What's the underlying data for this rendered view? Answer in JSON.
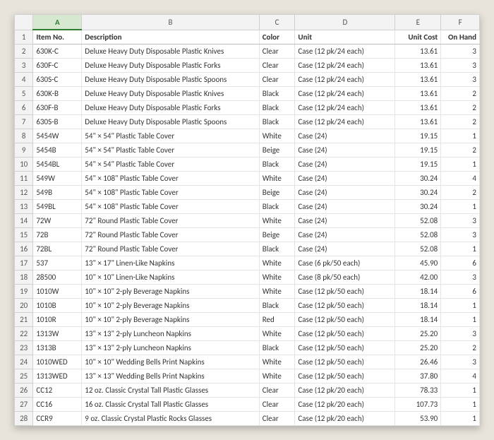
{
  "columns": [
    "A",
    "B",
    "C",
    "D",
    "E",
    "F"
  ],
  "selected_column": "A",
  "headers": {
    "item_no": "Item No.",
    "description": "Description",
    "color": "Color",
    "unit": "Unit",
    "unit_cost": "Unit Cost",
    "on_hand": "On Hand"
  },
  "rows": [
    {
      "n": 2,
      "item": "630K-C",
      "desc": "Deluxe Heavy Duty Disposable Plastic Knives",
      "color": "Clear",
      "unit": "Case (12 pk/24 each)",
      "cost": "13.61",
      "oh": "3"
    },
    {
      "n": 3,
      "item": "630F-C",
      "desc": "Deluxe Heavy Duty Disposable Plastic Forks",
      "color": "Clear",
      "unit": "Case (12 pk/24 each)",
      "cost": "13.61",
      "oh": "3"
    },
    {
      "n": 4,
      "item": "630S-C",
      "desc": "Deluxe Heavy Duty Disposable Plastic Spoons",
      "color": "Clear",
      "unit": "Case (12 pk/24 each)",
      "cost": "13.61",
      "oh": "3"
    },
    {
      "n": 5,
      "item": "630K-B",
      "desc": "Deluxe Heavy Duty Disposable Plastic Knives",
      "color": "Black",
      "unit": "Case (12 pk/24 each)",
      "cost": "13.61",
      "oh": "2"
    },
    {
      "n": 6,
      "item": "630F-B",
      "desc": "Deluxe Heavy Duty Disposable Plastic Forks",
      "color": "Black",
      "unit": "Case (12 pk/24 each)",
      "cost": "13.61",
      "oh": "2"
    },
    {
      "n": 7,
      "item": "630S-B",
      "desc": "Deluxe Heavy Duty Disposable Plastic Spoons",
      "color": "Black",
      "unit": "Case (12 pk/24 each)",
      "cost": "13.61",
      "oh": "2"
    },
    {
      "n": 8,
      "item": "5454W",
      "desc": "54\" × 54\" Plastic Table Cover",
      "color": "White",
      "unit": "Case (24)",
      "cost": "19.15",
      "oh": "1"
    },
    {
      "n": 9,
      "item": "5454B",
      "desc": "54\" × 54\" Plastic Table Cover",
      "color": "Beige",
      "unit": "Case (24)",
      "cost": "19.15",
      "oh": "2"
    },
    {
      "n": 10,
      "item": "5454BL",
      "desc": "54\" × 54\" Plastic Table Cover",
      "color": "Black",
      "unit": "Case (24)",
      "cost": "19.15",
      "oh": "1"
    },
    {
      "n": 11,
      "item": "549W",
      "desc": "54\" × 108\" Plastic Table Cover",
      "color": "White",
      "unit": "Case (24)",
      "cost": "30.24",
      "oh": "4"
    },
    {
      "n": 12,
      "item": "549B",
      "desc": "54\" × 108\" Plastic Table Cover",
      "color": "Beige",
      "unit": "Case (24)",
      "cost": "30.24",
      "oh": "2"
    },
    {
      "n": 13,
      "item": "549BL",
      "desc": "54\" × 108\" Plastic Table Cover",
      "color": "Black",
      "unit": "Case (24)",
      "cost": "30.24",
      "oh": "1"
    },
    {
      "n": 14,
      "item": "72W",
      "desc": "72\" Round Plastic Table Cover",
      "color": "White",
      "unit": "Case (24)",
      "cost": "52.08",
      "oh": "3"
    },
    {
      "n": 15,
      "item": "72B",
      "desc": "72\" Round Plastic Table Cover",
      "color": "Beige",
      "unit": "Case (24)",
      "cost": "52.08",
      "oh": "3"
    },
    {
      "n": 16,
      "item": "72BL",
      "desc": "72\" Round Plastic Table Cover",
      "color": "Black",
      "unit": "Case (24)",
      "cost": "52.08",
      "oh": "1"
    },
    {
      "n": 17,
      "item": "537",
      "desc": "13\" × 17\" Linen-Like Napkins",
      "color": "White",
      "unit": "Case (6 pk/50 each)",
      "cost": "45.90",
      "oh": "6"
    },
    {
      "n": 18,
      "item": "28500",
      "desc": "10\" × 10\" Linen-Like Napkins",
      "color": "White",
      "unit": "Case (8 pk/50 each)",
      "cost": "42.00",
      "oh": "3"
    },
    {
      "n": 19,
      "item": "1010W",
      "desc": "10\" × 10\" 2-ply Beverage Napkins",
      "color": "White",
      "unit": "Case (12 pk/50 each)",
      "cost": "18.14",
      "oh": "6"
    },
    {
      "n": 20,
      "item": "1010B",
      "desc": "10\" × 10\" 2-ply Beverage Napkins",
      "color": "Black",
      "unit": "Case (12 pk/50 each)",
      "cost": "18.14",
      "oh": "1"
    },
    {
      "n": 21,
      "item": "1010R",
      "desc": "10\" × 10\" 2-ply Beverage Napkins",
      "color": "Red",
      "unit": "Case (12 pk/50 each)",
      "cost": "18.14",
      "oh": "1"
    },
    {
      "n": 22,
      "item": "1313W",
      "desc": "13\" × 13\" 2-ply Luncheon Napkins",
      "color": "White",
      "unit": "Case (12 pk/50 each)",
      "cost": "25.20",
      "oh": "3"
    },
    {
      "n": 23,
      "item": "1313B",
      "desc": "13\" × 13\" 2-ply Luncheon Napkins",
      "color": "Black",
      "unit": "Case (12 pk/50 each)",
      "cost": "25.20",
      "oh": "2"
    },
    {
      "n": 24,
      "item": "1010WED",
      "desc": "10\" × 10\" Wedding Bells Print Napkins",
      "color": "White",
      "unit": "Case (12 pk/50 each)",
      "cost": "26.46",
      "oh": "3"
    },
    {
      "n": 25,
      "item": "1313WED",
      "desc": "13\" × 13\" Wedding Bells Print Napkins",
      "color": "White",
      "unit": "Case (12 pk/50 each)",
      "cost": "37.80",
      "oh": "4"
    },
    {
      "n": 26,
      "item": "CC12",
      "desc": "12 oz. Classic Crystal Tall Plastic Glasses",
      "color": "Clear",
      "unit": "Case (12 pk/20 each)",
      "cost": "78.33",
      "oh": "1"
    },
    {
      "n": 27,
      "item": "CC16",
      "desc": "16 oz. Classic Crystal Tall Plastic Glasses",
      "color": "Clear",
      "unit": "Case (12 pk/20 each)",
      "cost": "107.73",
      "oh": "1"
    },
    {
      "n": 28,
      "item": "CCR9",
      "desc": "9 oz. Classic Crystal Plastic Rocks Glasses",
      "color": "Clear",
      "unit": "Case (12 pk/20 each)",
      "cost": "53.90",
      "oh": "1"
    }
  ],
  "chart_data": {
    "type": "table",
    "columns": [
      "Item No.",
      "Description",
      "Color",
      "Unit",
      "Unit Cost",
      "On Hand"
    ],
    "data": [
      [
        "630K-C",
        "Deluxe Heavy Duty Disposable Plastic Knives",
        "Clear",
        "Case (12 pk/24 each)",
        13.61,
        3
      ],
      [
        "630F-C",
        "Deluxe Heavy Duty Disposable Plastic Forks",
        "Clear",
        "Case (12 pk/24 each)",
        13.61,
        3
      ],
      [
        "630S-C",
        "Deluxe Heavy Duty Disposable Plastic Spoons",
        "Clear",
        "Case (12 pk/24 each)",
        13.61,
        3
      ],
      [
        "630K-B",
        "Deluxe Heavy Duty Disposable Plastic Knives",
        "Black",
        "Case (12 pk/24 each)",
        13.61,
        2
      ],
      [
        "630F-B",
        "Deluxe Heavy Duty Disposable Plastic Forks",
        "Black",
        "Case (12 pk/24 each)",
        13.61,
        2
      ],
      [
        "630S-B",
        "Deluxe Heavy Duty Disposable Plastic Spoons",
        "Black",
        "Case (12 pk/24 each)",
        13.61,
        2
      ],
      [
        "5454W",
        "54\" × 54\" Plastic Table Cover",
        "White",
        "Case (24)",
        19.15,
        1
      ],
      [
        "5454B",
        "54\" × 54\" Plastic Table Cover",
        "Beige",
        "Case (24)",
        19.15,
        2
      ],
      [
        "5454BL",
        "54\" × 54\" Plastic Table Cover",
        "Black",
        "Case (24)",
        19.15,
        1
      ],
      [
        "549W",
        "54\" × 108\" Plastic Table Cover",
        "White",
        "Case (24)",
        30.24,
        4
      ],
      [
        "549B",
        "54\" × 108\" Plastic Table Cover",
        "Beige",
        "Case (24)",
        30.24,
        2
      ],
      [
        "549BL",
        "54\" × 108\" Plastic Table Cover",
        "Black",
        "Case (24)",
        30.24,
        1
      ],
      [
        "72W",
        "72\" Round Plastic Table Cover",
        "White",
        "Case (24)",
        52.08,
        3
      ],
      [
        "72B",
        "72\" Round Plastic Table Cover",
        "Beige",
        "Case (24)",
        52.08,
        3
      ],
      [
        "72BL",
        "72\" Round Plastic Table Cover",
        "Black",
        "Case (24)",
        52.08,
        1
      ],
      [
        "537",
        "13\" × 17\" Linen-Like Napkins",
        "White",
        "Case (6 pk/50 each)",
        45.9,
        6
      ],
      [
        "28500",
        "10\" × 10\" Linen-Like Napkins",
        "White",
        "Case (8 pk/50 each)",
        42.0,
        3
      ],
      [
        "1010W",
        "10\" × 10\" 2-ply Beverage Napkins",
        "White",
        "Case (12 pk/50 each)",
        18.14,
        6
      ],
      [
        "1010B",
        "10\" × 10\" 2-ply Beverage Napkins",
        "Black",
        "Case (12 pk/50 each)",
        18.14,
        1
      ],
      [
        "1010R",
        "10\" × 10\" 2-ply Beverage Napkins",
        "Red",
        "Case (12 pk/50 each)",
        18.14,
        1
      ],
      [
        "1313W",
        "13\" × 13\" 2-ply Luncheon Napkins",
        "White",
        "Case (12 pk/50 each)",
        25.2,
        3
      ],
      [
        "1313B",
        "13\" × 13\" 2-ply Luncheon Napkins",
        "Black",
        "Case (12 pk/50 each)",
        25.2,
        2
      ],
      [
        "1010WED",
        "10\" × 10\" Wedding Bells Print Napkins",
        "White",
        "Case (12 pk/50 each)",
        26.46,
        3
      ],
      [
        "1313WED",
        "13\" × 13\" Wedding Bells Print Napkins",
        "White",
        "Case (12 pk/50 each)",
        37.8,
        4
      ],
      [
        "CC12",
        "12 oz. Classic Crystal Tall Plastic Glasses",
        "Clear",
        "Case (12 pk/20 each)",
        78.33,
        1
      ],
      [
        "CC16",
        "16 oz. Classic Crystal Tall Plastic Glasses",
        "Clear",
        "Case (12 pk/20 each)",
        107.73,
        1
      ],
      [
        "CCR9",
        "9 oz. Classic Crystal Plastic Rocks Glasses",
        "Clear",
        "Case (12 pk/20 each)",
        53.9,
        1
      ]
    ]
  }
}
